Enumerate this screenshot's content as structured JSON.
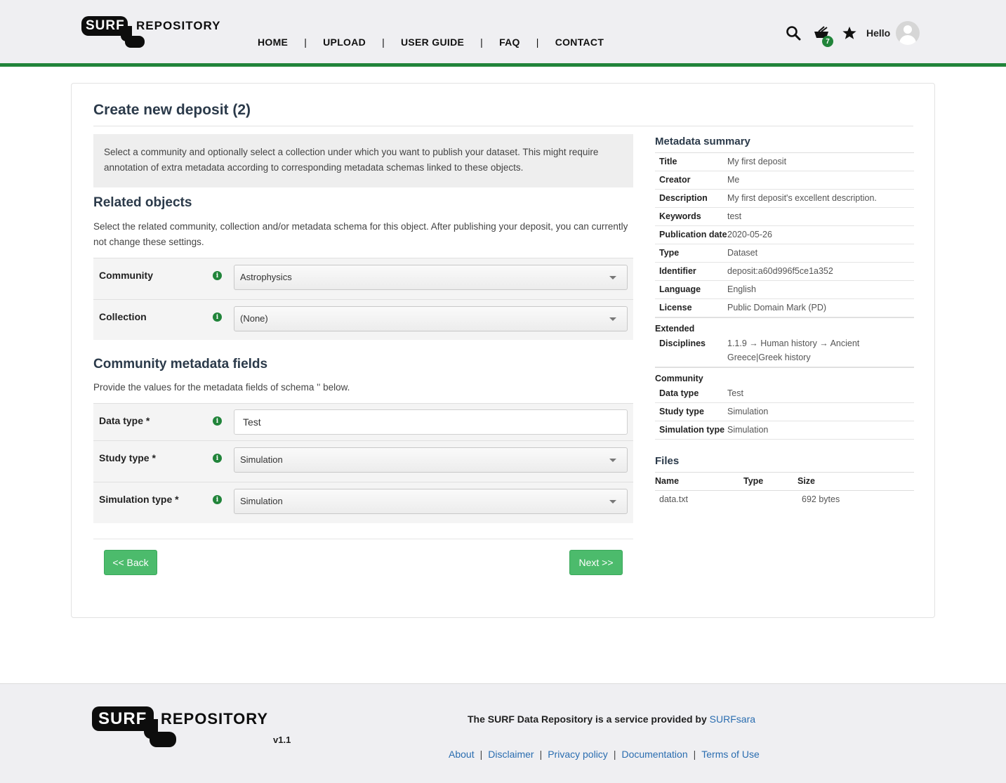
{
  "brand": {
    "surf": "SURF",
    "repository": "REPOSITORY",
    "version": "v1.1"
  },
  "nav": {
    "items": [
      "HOME",
      "UPLOAD",
      "USER GUIDE",
      "FAQ",
      "CONTACT"
    ],
    "separator": "|"
  },
  "header": {
    "cart_count": "7",
    "greeting": "Hello",
    "icons": [
      "search-icon",
      "cart-icon",
      "star-icon",
      "user-avatar-icon"
    ]
  },
  "page": {
    "title": "Create new deposit (2)",
    "intro": "Select a community and optionally select a collection under which you want to publish your dataset. This might require annotation of extra metadata according to corresponding metadata schemas linked to these objects.",
    "related_title": "Related objects",
    "related_text": "Select the related community, collection and/or metadata schema for this object. After publishing your deposit, you can currently not change these settings.",
    "community_label": "Community",
    "community_value": "Astrophysics",
    "collection_label": "Collection",
    "collection_value": "(None)",
    "cmf_title": "Community metadata fields",
    "cmf_text": "Provide the values for the metadata fields of schema '' below.",
    "data_type_label": "Data type *",
    "data_type_value": "Test",
    "study_type_label": "Study type *",
    "study_type_value": "Simulation",
    "sim_type_label": "Simulation type *",
    "sim_type_value": "Simulation",
    "back_label": "<< Back",
    "next_label": "Next >>",
    "info_glyph": "i"
  },
  "summary": {
    "title": "Metadata summary",
    "rows": [
      {
        "k": "Title",
        "v": "My first deposit"
      },
      {
        "k": "Creator",
        "v": "Me"
      },
      {
        "k": "Description",
        "v": "My first deposit's excellent description."
      },
      {
        "k": "Keywords",
        "v": "test"
      },
      {
        "k": "Publication date",
        "v": "2020-05-26"
      },
      {
        "k": "Type",
        "v": "Dataset"
      },
      {
        "k": "Identifier",
        "v": "deposit:a60d996f5ce1a352"
      },
      {
        "k": "Language",
        "v": "English"
      },
      {
        "k": "License",
        "v": "Public Domain Mark (PD)"
      }
    ],
    "extended_label": "Extended",
    "disciplines_label": "Disciplines",
    "disciplines_value": "1.1.9 → Human history → Ancient Greece|Greek history",
    "community_label": "Community",
    "community_rows": [
      {
        "k": "Data type",
        "v": "Test"
      },
      {
        "k": "Study type",
        "v": "Simulation"
      },
      {
        "k": "Simulation type",
        "v": "Simulation"
      }
    ],
    "files_title": "Files",
    "files_headers": [
      "Name",
      "Type",
      "Size"
    ],
    "files": [
      {
        "name": "data.txt",
        "type": "",
        "size": "692 bytes"
      }
    ]
  },
  "footer": {
    "provided_text": "The SURF Data Repository is a service provided by",
    "provider": "SURFsara",
    "links": [
      "About",
      "Disclaimer",
      "Privacy policy",
      "Documentation",
      "Terms of Use"
    ],
    "separator": "|"
  },
  "colors": {
    "accent_green": "#21843a",
    "button_green": "#4cbb6c",
    "link_blue": "#2a6db0"
  }
}
